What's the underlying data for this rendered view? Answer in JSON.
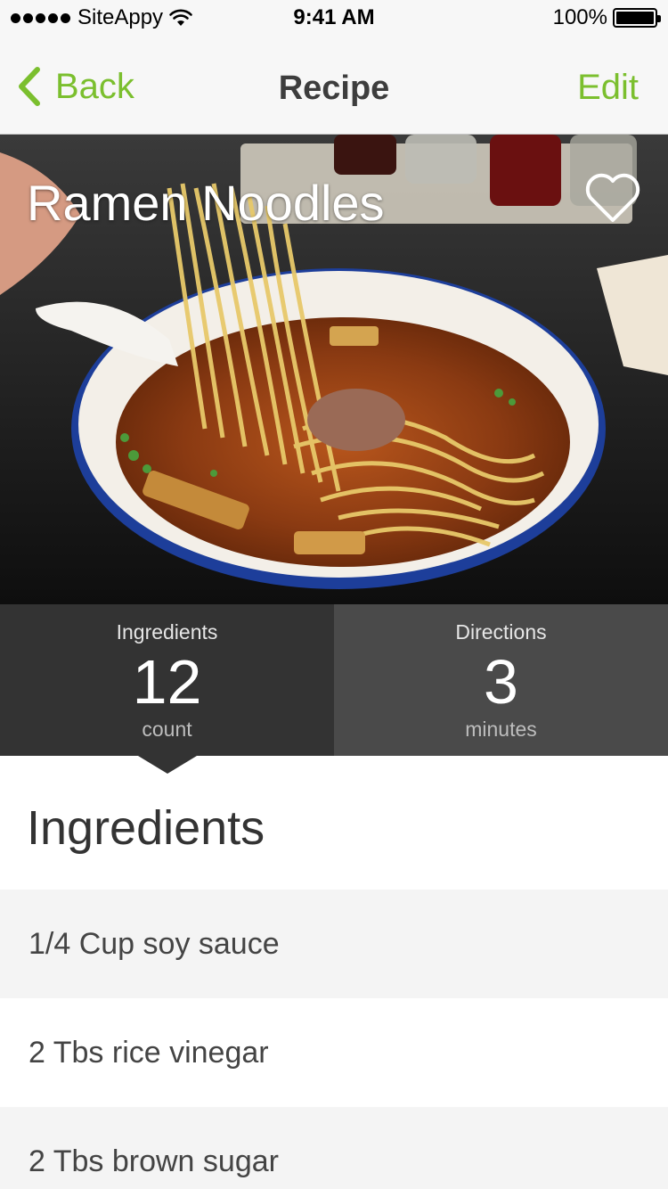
{
  "status_bar": {
    "carrier": "SiteAppy",
    "time": "9:41 AM",
    "battery": "100%",
    "signal_icon": "signal-dots-icon",
    "wifi_icon": "wifi-icon",
    "battery_icon": "battery-icon"
  },
  "nav": {
    "back_label": "Back",
    "back_icon": "chevron-left-icon",
    "title": "Recipe",
    "edit_label": "Edit",
    "accent_color": "#7bbf2e"
  },
  "hero": {
    "title": "Ramen Noodles",
    "favorite_icon": "heart-outline-icon"
  },
  "stats": {
    "ingredients": {
      "label": "Ingredients",
      "value": "12",
      "unit": "count"
    },
    "directions": {
      "label": "Directions",
      "value": "3",
      "unit": "minutes"
    }
  },
  "section": {
    "heading": "Ingredients"
  },
  "ingredients": [
    "1/4 Cup soy sauce",
    "2 Tbs rice vinegar",
    "2 Tbs brown sugar"
  ]
}
